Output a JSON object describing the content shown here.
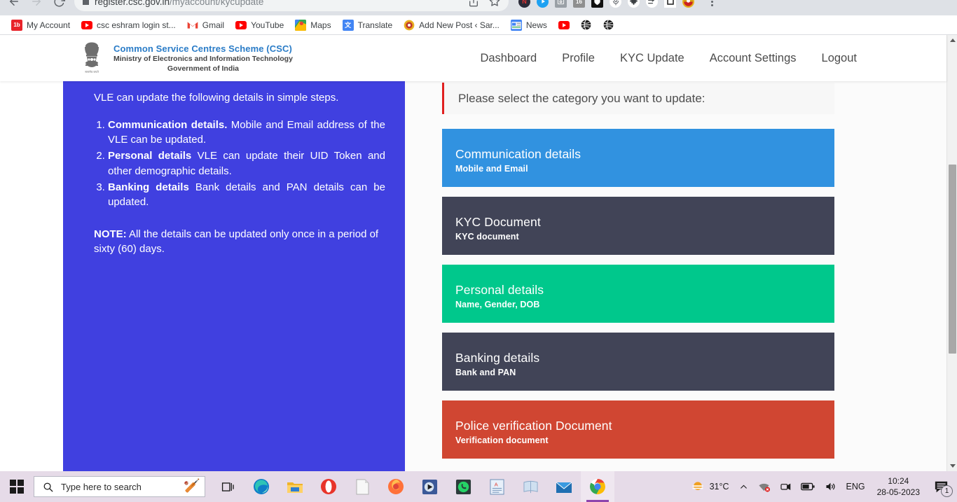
{
  "browser": {
    "url_host": "register.csc.gov.in",
    "url_path": "/myaccount/kycupdate",
    "back_icon": "back-arrow-icon",
    "forward_icon": "forward-arrow-icon",
    "reload_icon": "reload-icon",
    "share_icon": "share-icon",
    "bookmark_star_icon": "star-icon",
    "menu_icon": "kebab-menu-icon",
    "extensions": [
      {
        "name": "norton-extension-icon",
        "glyph": "N",
        "bg": "#2b2b38",
        "fg": "#e03030"
      },
      {
        "name": "twitter-extension-icon",
        "glyph": "",
        "bg": "#1da1f2",
        "fg": "#ffffff"
      },
      {
        "name": "screenshot-extension-icon",
        "glyph": "",
        "bg": "#9aa0a6",
        "fg": "#ffffff"
      },
      {
        "name": "grammar-extension-icon",
        "glyph": "16",
        "bg": "#8f8f8f",
        "fg": "#ffffff"
      },
      {
        "name": "adblock-shield-icon",
        "glyph": "",
        "bg": "#111111",
        "fg": "#ffffff"
      },
      {
        "name": "microphone-extension-icon",
        "glyph": "",
        "bg": "#ffffff",
        "fg": "#5f6368"
      },
      {
        "name": "puzzle-extensions-icon",
        "glyph": "",
        "bg": "#ffffff",
        "fg": "#3c4043"
      },
      {
        "name": "sync-extension-icon",
        "glyph": "",
        "bg": "#ffffff",
        "fg": "#3c4043"
      },
      {
        "name": "tab-extension-icon",
        "glyph": "",
        "bg": "#ffffff",
        "fg": "#1b1b1b"
      },
      {
        "name": "profile-avatar-icon",
        "glyph": "",
        "bg": "#e0a020",
        "fg": "#ffffff"
      }
    ],
    "bookmarks": [
      {
        "label": "My Account",
        "icon": "hotstar-favicon",
        "glyph": "1b",
        "bg": "#e8232a",
        "fg": "#ffffff"
      },
      {
        "label": "csc eshram login st...",
        "icon": "youtube-favicon",
        "glyph": "",
        "bg": "#ff0000",
        "fg": "#ffffff"
      },
      {
        "label": "Gmail",
        "icon": "gmail-favicon",
        "glyph": "M",
        "bg": "#ffffff",
        "fg": "#ea4335"
      },
      {
        "label": "YouTube",
        "icon": "youtube-favicon",
        "glyph": "",
        "bg": "#ff0000",
        "fg": "#ffffff"
      },
      {
        "label": "Maps",
        "icon": "google-maps-favicon",
        "glyph": "",
        "bg": "#34a853",
        "fg": "#ffffff"
      },
      {
        "label": "Translate",
        "icon": "google-translate-favicon",
        "glyph": "文",
        "bg": "#4285f4",
        "fg": "#ffffff"
      },
      {
        "label": "Add New Post ‹ Sar...",
        "icon": "wordpress-favicon",
        "glyph": "",
        "bg": "#e8b020",
        "fg": "#c0392b"
      },
      {
        "label": "News",
        "icon": "google-news-favicon",
        "glyph": "N",
        "bg": "#4285f4",
        "fg": "#ffffff"
      },
      {
        "label": "",
        "icon": "youtube-favicon",
        "glyph": "",
        "bg": "#ff0000",
        "fg": "#ffffff"
      },
      {
        "label": "",
        "icon": "globe-favicon",
        "glyph": "",
        "bg": "#1b1b1b",
        "fg": "#ffffff"
      },
      {
        "label": "",
        "icon": "globe-favicon",
        "glyph": "",
        "bg": "#1b1b1b",
        "fg": "#ffffff"
      }
    ]
  },
  "site": {
    "logo": {
      "icon": "india-national-emblem-icon",
      "line1": "Common Service Centres Scheme (CSC)",
      "line2": "Ministry of Electronics and Information Technology",
      "line3": "Government of India"
    },
    "nav": [
      {
        "label": "Dashboard",
        "name": "nav-dashboard"
      },
      {
        "label": "Profile",
        "name": "nav-profile"
      },
      {
        "label": "KYC Update",
        "name": "nav-kyc-update"
      },
      {
        "label": "Account Settings",
        "name": "nav-account-settings"
      },
      {
        "label": "Logout",
        "name": "nav-logout"
      }
    ]
  },
  "info_panel": {
    "background_color": "#4040e0",
    "lead": "VLE can update the following details in simple steps.",
    "items": [
      {
        "bold": "Communication details.",
        "rest": " Mobile and Email address of the VLE can be updated."
      },
      {
        "bold": "Personal details",
        "rest": " VLE can update their UID Token and other demographic details."
      },
      {
        "bold": "Banking details",
        "rest": " Bank details and PAN details can be updated."
      }
    ],
    "note_label": "NOTE:",
    "note_text": " All the details can be updated only once in a period of sixty (60) days."
  },
  "update_panel": {
    "prompt": "Please select the category you want to update:",
    "prompt_accent_color": "#e02020",
    "cards": [
      {
        "title": "Communication details",
        "subtitle": "Mobile and Email",
        "color": "#3192e0",
        "name": "card-communication-details"
      },
      {
        "title": "KYC Document",
        "subtitle": "KYC document",
        "color": "#414457",
        "name": "card-kyc-document"
      },
      {
        "title": "Personal details",
        "subtitle": "Name, Gender, DOB",
        "color": "#00c88c",
        "name": "card-personal-details"
      },
      {
        "title": "Banking details",
        "subtitle": "Bank and PAN",
        "color": "#414457",
        "name": "card-banking-details"
      },
      {
        "title": "Police verification Document",
        "subtitle": "Verification document",
        "color": "#d04632",
        "name": "card-police-verification-document"
      }
    ]
  },
  "taskbar": {
    "start_icon": "windows-start-icon",
    "search_placeholder": "Type here to search",
    "search_icon": "search-icon",
    "search_decoration": "cricket-bat-and-ball-icon",
    "task_view_icon": "task-view-icon",
    "apps": [
      {
        "name": "edge-taskbar-icon",
        "glyph": "edge"
      },
      {
        "name": "file-explorer-taskbar-icon",
        "glyph": "folder"
      },
      {
        "name": "opera-taskbar-icon",
        "glyph": "opera"
      },
      {
        "name": "document-taskbar-icon",
        "glyph": "doc"
      },
      {
        "name": "firefox-taskbar-icon",
        "glyph": "firefox"
      },
      {
        "name": "media-player-taskbar-icon",
        "glyph": "media"
      },
      {
        "name": "whatsapp-taskbar-icon",
        "glyph": "whatsapp"
      },
      {
        "name": "dictionary-taskbar-icon",
        "glyph": "dict"
      },
      {
        "name": "notepad-taskbar-icon",
        "glyph": "notepad"
      },
      {
        "name": "mail-taskbar-icon",
        "glyph": "mail"
      },
      {
        "name": "chrome-taskbar-icon",
        "glyph": "chrome"
      }
    ],
    "tray": {
      "weather_icon": "sun-weather-icon",
      "temperature": "31°C",
      "chevron_icon": "show-hidden-icons-chevron",
      "network_icon": "network-disconnected-icon",
      "camera_icon": "camera-icon",
      "battery_icon": "battery-icon",
      "volume_icon": "volume-icon",
      "language": "ENG",
      "time": "10:24",
      "date": "28-05-2023",
      "notification_icon": "notification-chat-icon",
      "notification_count": "1"
    }
  }
}
